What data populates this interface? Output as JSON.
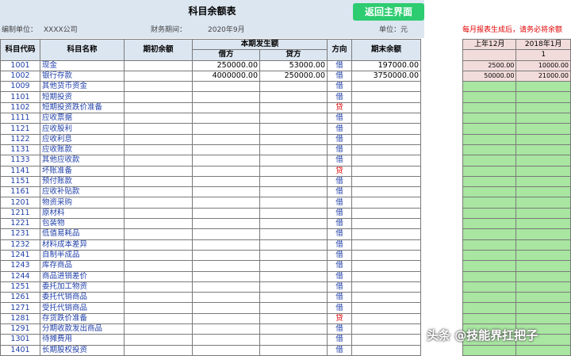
{
  "header": {
    "title": "科目余额表",
    "home_button": "返回主界面",
    "unit_label": "编制单位：",
    "unit_value": "XXXX公司",
    "period_label": "财务期间：",
    "period_value": "2020年9月",
    "currency_label": "单位：元",
    "note": "每月报表生成后，请务必将余额"
  },
  "table": {
    "headers": {
      "code": "科目代码",
      "name": "科目名称",
      "opening": "期初余额",
      "period_amount": "本期发生额",
      "debit": "借方",
      "credit": "贷方",
      "direction": "方向",
      "closing": "期末余额"
    },
    "rows": [
      {
        "code": "1001",
        "name": "现金",
        "opening": "",
        "debit": "250000.00",
        "credit": "53000.00",
        "dir": "借",
        "closing": "197000.00"
      },
      {
        "code": "1002",
        "name": "银行存款",
        "opening": "",
        "debit": "4000000.00",
        "credit": "250000.00",
        "dir": "借",
        "closing": "3750000.00"
      },
      {
        "code": "1009",
        "name": "其他货币资金",
        "opening": "",
        "debit": "",
        "credit": "",
        "dir": "借",
        "closing": ""
      },
      {
        "code": "1101",
        "name": "短期投资",
        "opening": "",
        "debit": "",
        "credit": "",
        "dir": "借",
        "closing": ""
      },
      {
        "code": "1102",
        "name": "短期投资跌价准备",
        "opening": "",
        "debit": "",
        "credit": "",
        "dir": "贷",
        "closing": ""
      },
      {
        "code": "1111",
        "name": "应收票据",
        "opening": "",
        "debit": "",
        "credit": "",
        "dir": "借",
        "closing": ""
      },
      {
        "code": "1121",
        "name": "应收股利",
        "opening": "",
        "debit": "",
        "credit": "",
        "dir": "借",
        "closing": ""
      },
      {
        "code": "1122",
        "name": "应收利息",
        "opening": "",
        "debit": "",
        "credit": "",
        "dir": "借",
        "closing": ""
      },
      {
        "code": "1131",
        "name": "应收账款",
        "opening": "",
        "debit": "",
        "credit": "",
        "dir": "借",
        "closing": ""
      },
      {
        "code": "1133",
        "name": "其他应收款",
        "opening": "",
        "debit": "",
        "credit": "",
        "dir": "借",
        "closing": ""
      },
      {
        "code": "1141",
        "name": "坏账准备",
        "opening": "",
        "debit": "",
        "credit": "",
        "dir": "贷",
        "closing": ""
      },
      {
        "code": "1151",
        "name": "预付账款",
        "opening": "",
        "debit": "",
        "credit": "",
        "dir": "借",
        "closing": ""
      },
      {
        "code": "1161",
        "name": "应收补贴款",
        "opening": "",
        "debit": "",
        "credit": "",
        "dir": "借",
        "closing": ""
      },
      {
        "code": "1201",
        "name": "物资采购",
        "opening": "",
        "debit": "",
        "credit": "",
        "dir": "借",
        "closing": ""
      },
      {
        "code": "1211",
        "name": "原材料",
        "opening": "",
        "debit": "",
        "credit": "",
        "dir": "借",
        "closing": ""
      },
      {
        "code": "1221",
        "name": "包装物",
        "opening": "",
        "debit": "",
        "credit": "",
        "dir": "借",
        "closing": ""
      },
      {
        "code": "1231",
        "name": "低值易耗品",
        "opening": "",
        "debit": "",
        "credit": "",
        "dir": "借",
        "closing": ""
      },
      {
        "code": "1232",
        "name": "材料成本差异",
        "opening": "",
        "debit": "",
        "credit": "",
        "dir": "借",
        "closing": ""
      },
      {
        "code": "1241",
        "name": "自制半成品",
        "opening": "",
        "debit": "",
        "credit": "",
        "dir": "借",
        "closing": ""
      },
      {
        "code": "1243",
        "name": "库存商品",
        "opening": "",
        "debit": "",
        "credit": "",
        "dir": "借",
        "closing": ""
      },
      {
        "code": "1244",
        "name": "商品进销差价",
        "opening": "",
        "debit": "",
        "credit": "",
        "dir": "借",
        "closing": ""
      },
      {
        "code": "1251",
        "name": "委托加工物资",
        "opening": "",
        "debit": "",
        "credit": "",
        "dir": "借",
        "closing": ""
      },
      {
        "code": "1261",
        "name": "委托代销商品",
        "opening": "",
        "debit": "",
        "credit": "",
        "dir": "借",
        "closing": ""
      },
      {
        "code": "1271",
        "name": "受托代销商品",
        "opening": "",
        "debit": "",
        "credit": "",
        "dir": "借",
        "closing": ""
      },
      {
        "code": "1281",
        "name": "存货跌价准备",
        "opening": "",
        "debit": "",
        "credit": "",
        "dir": "贷",
        "closing": ""
      },
      {
        "code": "1291",
        "name": "分期收款发出商品",
        "opening": "",
        "debit": "",
        "credit": "",
        "dir": "借",
        "closing": ""
      },
      {
        "code": "1301",
        "name": "待摊费用",
        "opening": "",
        "debit": "",
        "credit": "",
        "dir": "借",
        "closing": ""
      },
      {
        "code": "1401",
        "name": "长期股权投资",
        "opening": "",
        "debit": "",
        "credit": "",
        "dir": "借",
        "closing": ""
      }
    ]
  },
  "side": {
    "headers": [
      "上年12月",
      "2018年1月"
    ],
    "index": "1",
    "rows": [
      [
        "2500.00",
        "10000.00"
      ],
      [
        "50000.00",
        "21000.00"
      ]
    ]
  },
  "watermark": "头条 @技能界扛把子"
}
